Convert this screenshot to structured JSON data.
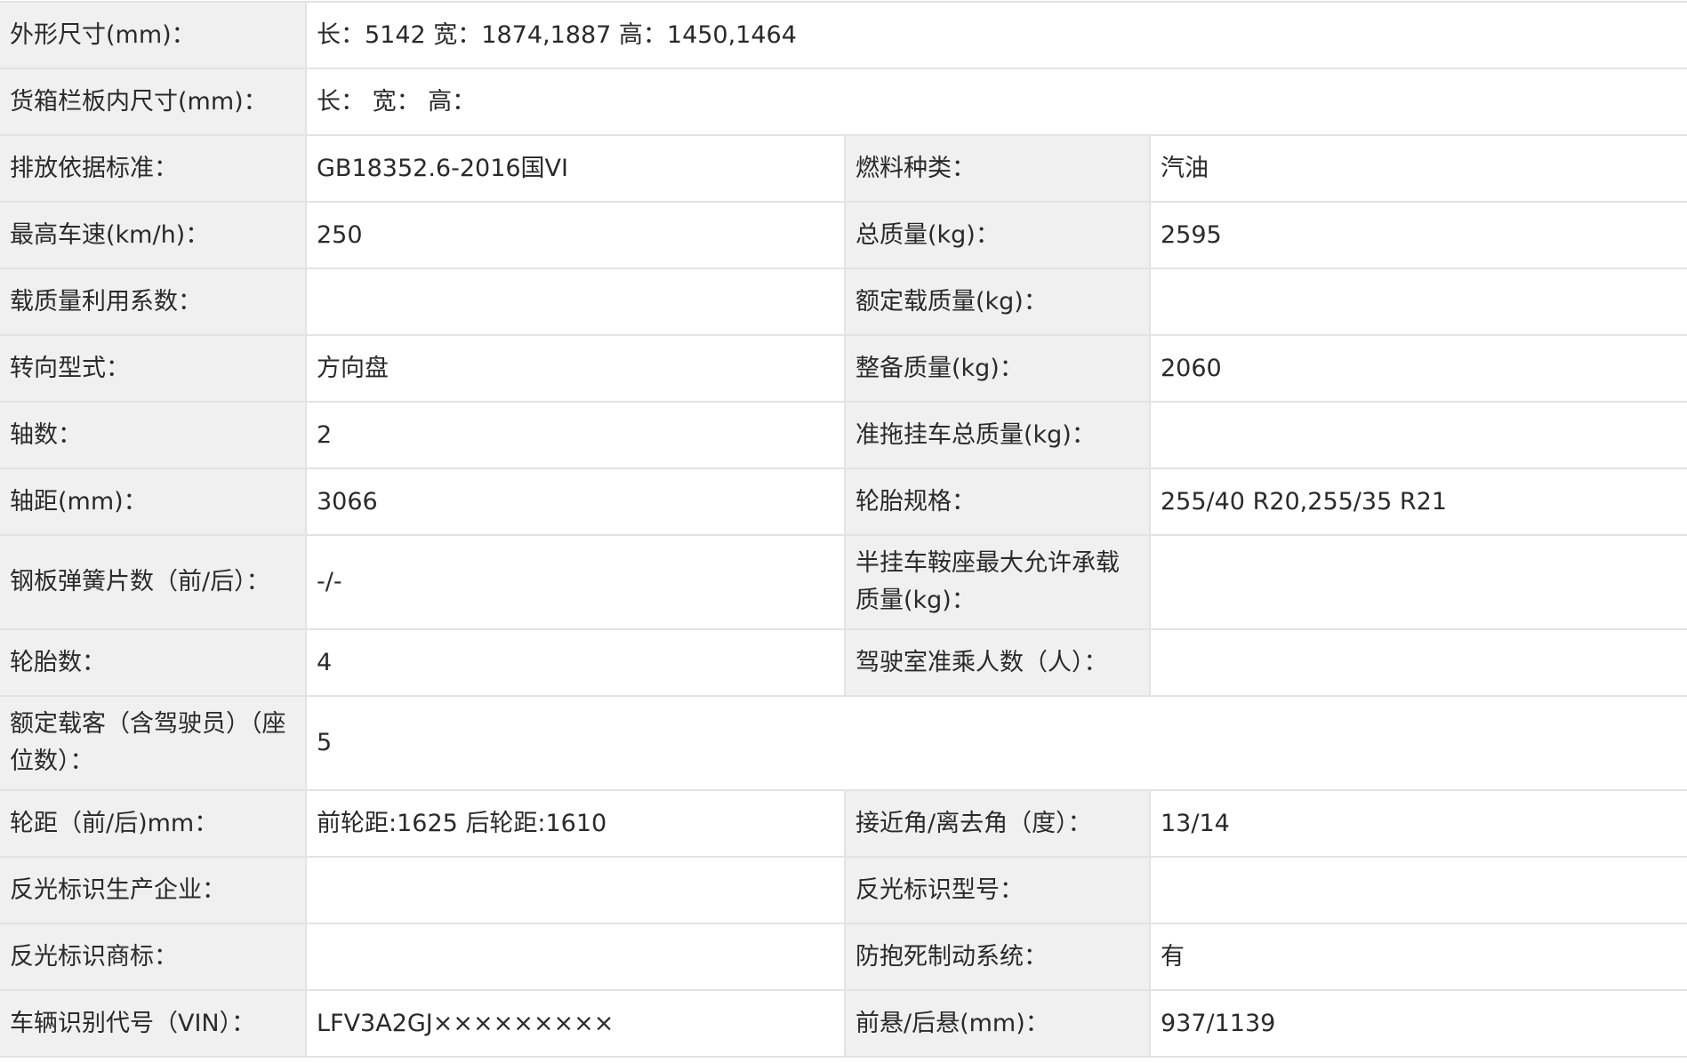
{
  "rows": [
    {
      "label": "外形尺寸(mm)：",
      "value": "长：5142 宽：1874,1887 高：1450,1464",
      "full": true
    },
    {
      "label": "货箱栏板内尺寸(mm)：",
      "value": "长： 宽： 高：",
      "full": true
    },
    {
      "label": "排放依据标准：",
      "value": "GB18352.6-2016国VI",
      "label2": "燃料种类：",
      "value2": "汽油"
    },
    {
      "label": "最高车速(km/h)：",
      "value": "250",
      "label2": "总质量(kg)：",
      "value2": "2595"
    },
    {
      "label": "载质量利用系数：",
      "value": "",
      "label2": "额定载质量(kg)：",
      "value2": ""
    },
    {
      "label": "转向型式：",
      "value": "方向盘",
      "label2": "整备质量(kg)：",
      "value2": "2060"
    },
    {
      "label": "轴数：",
      "value": "2",
      "label2": "准拖挂车总质量(kg)：",
      "value2": ""
    },
    {
      "label": "轴距(mm)：",
      "value": "3066",
      "label2": "轮胎规格：",
      "value2": "255/40 R20,255/35 R21"
    },
    {
      "label": "钢板弹簧片数（前/后）：",
      "value": "-/-",
      "label2": "半挂车鞍座最大允许承载质量(kg)：",
      "value2": ""
    },
    {
      "label": "轮胎数：",
      "value": "4",
      "label2": "驾驶室准乘人数（人）：",
      "value2": ""
    },
    {
      "label": "额定载客（含驾驶员）（座位数）：",
      "value": "5",
      "full": true
    },
    {
      "label": "轮距（前/后)mm：",
      "value": "前轮距:1625 后轮距:1610",
      "label2": "接近角/离去角（度）：",
      "value2": "13/14"
    },
    {
      "label": "反光标识生产企业：",
      "value": "",
      "label2": "反光标识型号：",
      "value2": ""
    },
    {
      "label": "反光标识商标：",
      "value": "",
      "label2": "防抱死制动系统：",
      "value2": "有"
    },
    {
      "label": "车辆识别代号（VIN）：",
      "value": "LFV3A2GJ×××××××××",
      "label2": "前悬/后悬(mm)：",
      "value2": "937/1139"
    }
  ]
}
